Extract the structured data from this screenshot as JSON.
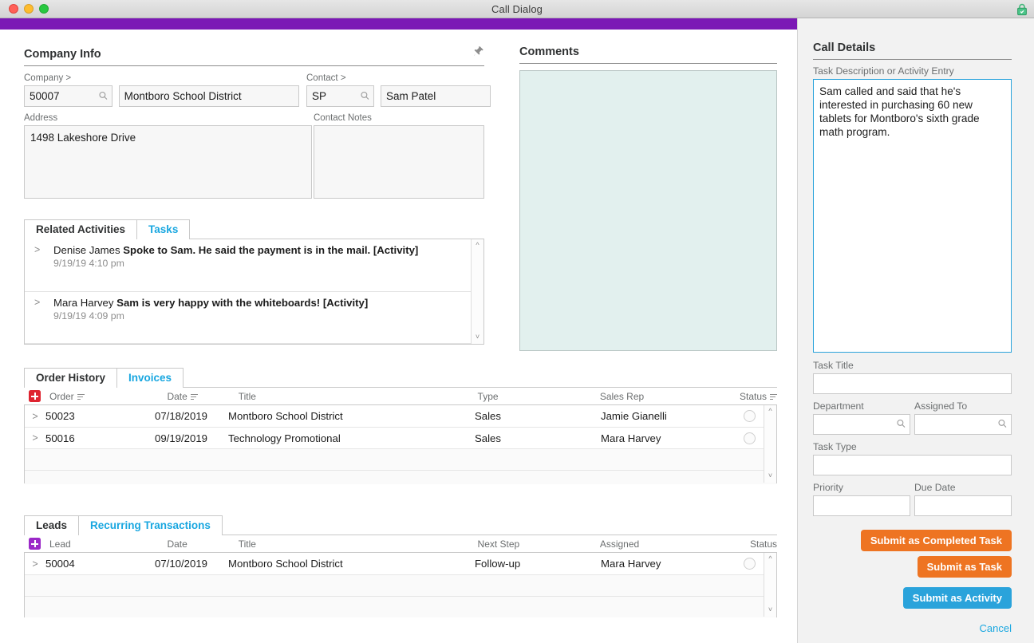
{
  "window": {
    "title": "Call Dialog",
    "accent_color": "#7b18b5",
    "lock_icon": "lock-icon"
  },
  "company_info": {
    "heading": "Company Info",
    "pin_icon": "pin-icon",
    "company_label": "Company >",
    "company_code": "50007",
    "company_name": "Montboro School District",
    "contact_label": "Contact >",
    "contact_code": "SP",
    "contact_name": "Sam Patel",
    "address_label": "Address",
    "address_value": "1498 Lakeshore Drive",
    "contact_notes_label": "Contact Notes",
    "contact_notes_value": ""
  },
  "comments": {
    "heading": "Comments",
    "value": "",
    "bg_color": "#e2f0ee"
  },
  "activities_panel": {
    "tabs": [
      {
        "label": "Related Activities",
        "active": true
      },
      {
        "label": "Tasks",
        "active": false
      }
    ],
    "rows": [
      {
        "caret": ">",
        "author": "Denise James ",
        "text": "Spoke to Sam. He said the payment is in the mail. [Activity]",
        "timestamp": "9/19/19  4:10 pm"
      },
      {
        "caret": ">",
        "author": "Mara Harvey ",
        "text": "Sam is very happy with the whiteboards! [Activity]",
        "timestamp": "9/19/19  4:09 pm"
      }
    ]
  },
  "order_history": {
    "tabs": [
      {
        "label": "Order History",
        "active": true
      },
      {
        "label": "Invoices",
        "active": false
      }
    ],
    "add_icon": "add-row-icon",
    "add_icon_color": "#de2430",
    "columns": [
      "Order",
      "Date",
      "Title",
      "Type",
      "Sales Rep",
      "Status"
    ],
    "sortable": [
      true,
      true,
      false,
      false,
      false,
      true
    ],
    "rows": [
      {
        "caret": ">",
        "order": "50023",
        "date": "07/18/2019",
        "title": "Montboro School District",
        "type": "Sales",
        "sales_rep": "Jamie Gianelli",
        "status": ""
      },
      {
        "caret": ">",
        "order": "50016",
        "date": "09/19/2019",
        "title": "Technology Promotional",
        "type": "Sales",
        "sales_rep": "Mara Harvey",
        "status": ""
      }
    ]
  },
  "leads": {
    "tabs": [
      {
        "label": "Leads",
        "active": true
      },
      {
        "label": "Recurring Transactions",
        "active": false
      }
    ],
    "add_icon": "add-row-icon",
    "add_icon_color": "#9b28c8",
    "columns": [
      "Lead",
      "Date",
      "Title",
      "Next Step",
      "Assigned",
      "Status"
    ],
    "rows": [
      {
        "caret": ">",
        "lead": "50004",
        "date": "07/10/2019",
        "title": "Montboro School District",
        "next_step": "Follow-up",
        "assigned": "Mara Harvey",
        "status": ""
      }
    ]
  },
  "call_details": {
    "heading": "Call Details",
    "task_description_label": "Task Description or Activity Entry",
    "task_description_value": "Sam called and said that he's interested in purchasing 60 new tablets for Montboro's sixth grade math program.",
    "task_title_label": "Task Title",
    "task_title_value": "",
    "department_label": "Department",
    "department_value": "",
    "assigned_to_label": "Assigned To",
    "assigned_to_value": "",
    "task_type_label": "Task Type",
    "task_type_value": "",
    "priority_label": "Priority",
    "priority_value": "",
    "due_date_label": "Due Date",
    "due_date_value": "",
    "buttons": {
      "submit_completed_task": "Submit as Completed Task",
      "submit_task": "Submit as Task",
      "submit_activity": "Submit as Activity",
      "cancel": "Cancel"
    },
    "colors": {
      "orange": "#ee7422",
      "blue": "#2aa3db",
      "link": "#19a7e0",
      "focus": "#2aa3db"
    }
  }
}
